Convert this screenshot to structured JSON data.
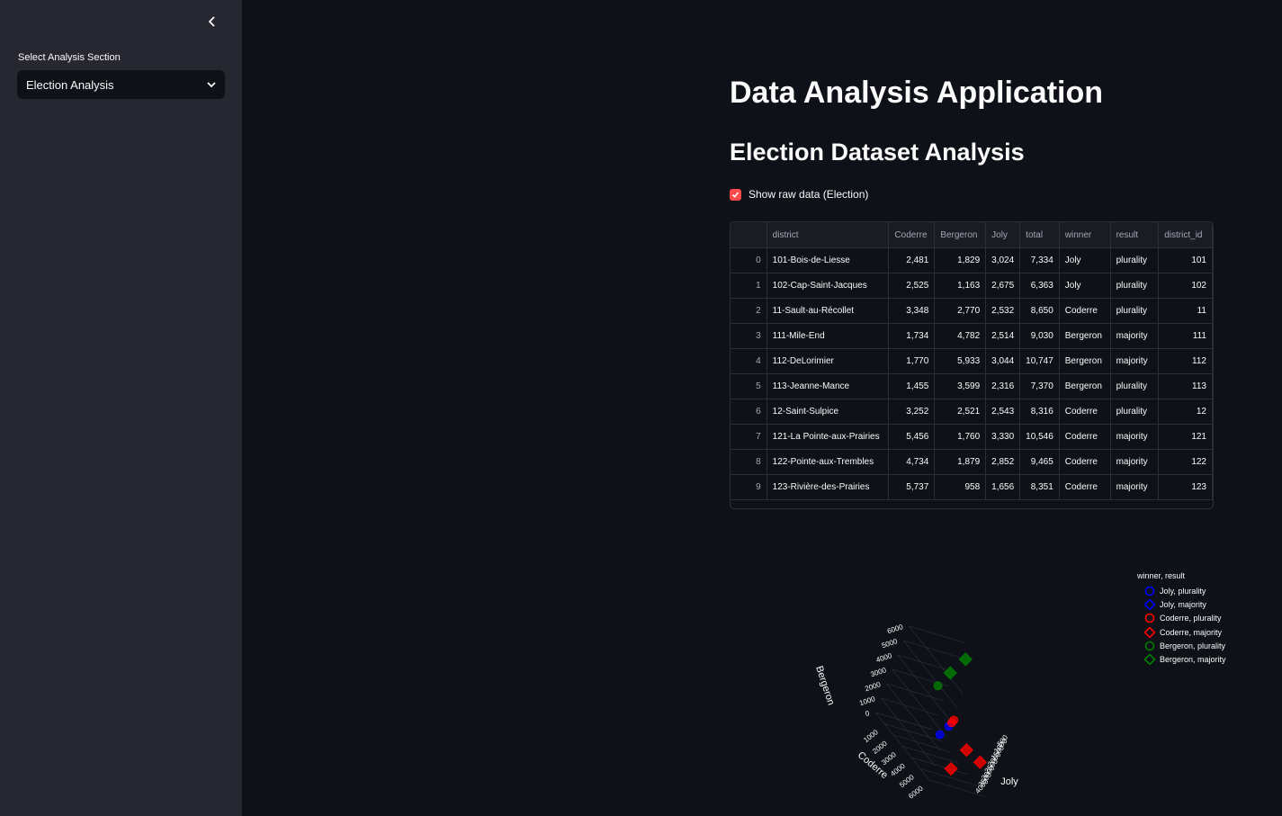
{
  "sidebar": {
    "section_label": "Select Analysis Section",
    "selected_section": "Election Analysis"
  },
  "main": {
    "title": "Data Analysis Application",
    "subtitle": "Election Dataset Analysis",
    "checkbox_label": "Show raw data (Election)",
    "checkbox_checked": true
  },
  "table": {
    "columns": [
      "",
      "district",
      "Coderre",
      "Bergeron",
      "Joly",
      "total",
      "winner",
      "result",
      "district_id"
    ],
    "rows": [
      [
        "0",
        "101-Bois-de-Liesse",
        "2,481",
        "1,829",
        "3,024",
        "7,334",
        "Joly",
        "plurality",
        "101"
      ],
      [
        "1",
        "102-Cap-Saint-Jacques",
        "2,525",
        "1,163",
        "2,675",
        "6,363",
        "Joly",
        "plurality",
        "102"
      ],
      [
        "2",
        "11-Sault-au-Récollet",
        "3,348",
        "2,770",
        "2,532",
        "8,650",
        "Coderre",
        "plurality",
        "11"
      ],
      [
        "3",
        "111-Mile-End",
        "1,734",
        "4,782",
        "2,514",
        "9,030",
        "Bergeron",
        "majority",
        "111"
      ],
      [
        "4",
        "112-DeLorimier",
        "1,770",
        "5,933",
        "3,044",
        "10,747",
        "Bergeron",
        "majority",
        "112"
      ],
      [
        "5",
        "113-Jeanne-Mance",
        "1,455",
        "3,599",
        "2,316",
        "7,370",
        "Bergeron",
        "plurality",
        "113"
      ],
      [
        "6",
        "12-Saint-Sulpice",
        "3,252",
        "2,521",
        "2,543",
        "8,316",
        "Coderre",
        "plurality",
        "12"
      ],
      [
        "7",
        "121-La Pointe-aux-Prairies",
        "5,456",
        "1,760",
        "3,330",
        "10,546",
        "Coderre",
        "majority",
        "121"
      ],
      [
        "8",
        "122-Pointe-aux-Trembles",
        "4,734",
        "1,879",
        "2,852",
        "9,465",
        "Coderre",
        "majority",
        "122"
      ],
      [
        "9",
        "123-Rivière-des-Prairies",
        "5,737",
        "958",
        "1,656",
        "8,351",
        "Coderre",
        "majority",
        "123"
      ]
    ]
  },
  "chart_data": {
    "type": "scatter",
    "axes": {
      "x": {
        "label": "Joly",
        "ticks": [
          "500",
          "1000",
          "1500",
          "2000",
          "2500",
          "3000",
          "3500",
          "4000"
        ]
      },
      "y": {
        "label": "Coderre",
        "ticks": [
          "1000",
          "2000",
          "3000",
          "4000",
          "5000",
          "6000"
        ]
      },
      "z": {
        "label": "Bergeron",
        "ticks": [
          "0",
          "1000",
          "2000",
          "3000",
          "4000",
          "5000",
          "6000"
        ]
      }
    },
    "legend_title": "winner, result",
    "legend": [
      {
        "label": "Joly, plurality",
        "color": "#0000ff",
        "symbol": "circle"
      },
      {
        "label": "Joly, majority",
        "color": "#0000ff",
        "symbol": "diamond"
      },
      {
        "label": "Coderre, plurality",
        "color": "#ff0000",
        "symbol": "circle"
      },
      {
        "label": "Coderre, majority",
        "color": "#ff0000",
        "symbol": "diamond"
      },
      {
        "label": "Bergeron, plurality",
        "color": "#008000",
        "symbol": "circle"
      },
      {
        "label": "Bergeron, majority",
        "color": "#008000",
        "symbol": "diamond"
      }
    ],
    "series": [
      {
        "name": "Joly, plurality",
        "points": [
          {
            "coderre": 2481,
            "bergeron": 1829,
            "joly": 3024
          },
          {
            "coderre": 2525,
            "bergeron": 1163,
            "joly": 2675
          }
        ]
      },
      {
        "name": "Coderre, plurality",
        "points": [
          {
            "coderre": 3348,
            "bergeron": 2770,
            "joly": 2532
          },
          {
            "coderre": 3252,
            "bergeron": 2521,
            "joly": 2543
          }
        ]
      },
      {
        "name": "Coderre, majority",
        "points": [
          {
            "coderre": 5456,
            "bergeron": 1760,
            "joly": 3330
          },
          {
            "coderre": 4734,
            "bergeron": 1879,
            "joly": 2852
          },
          {
            "coderre": 5737,
            "bergeron": 958,
            "joly": 1656
          }
        ]
      },
      {
        "name": "Bergeron, plurality",
        "points": [
          {
            "coderre": 1455,
            "bergeron": 3599,
            "joly": 2316
          }
        ]
      },
      {
        "name": "Bergeron, majority",
        "points": [
          {
            "coderre": 1734,
            "bergeron": 4782,
            "joly": 2514
          },
          {
            "coderre": 1770,
            "bergeron": 5933,
            "joly": 3044
          }
        ]
      }
    ]
  }
}
